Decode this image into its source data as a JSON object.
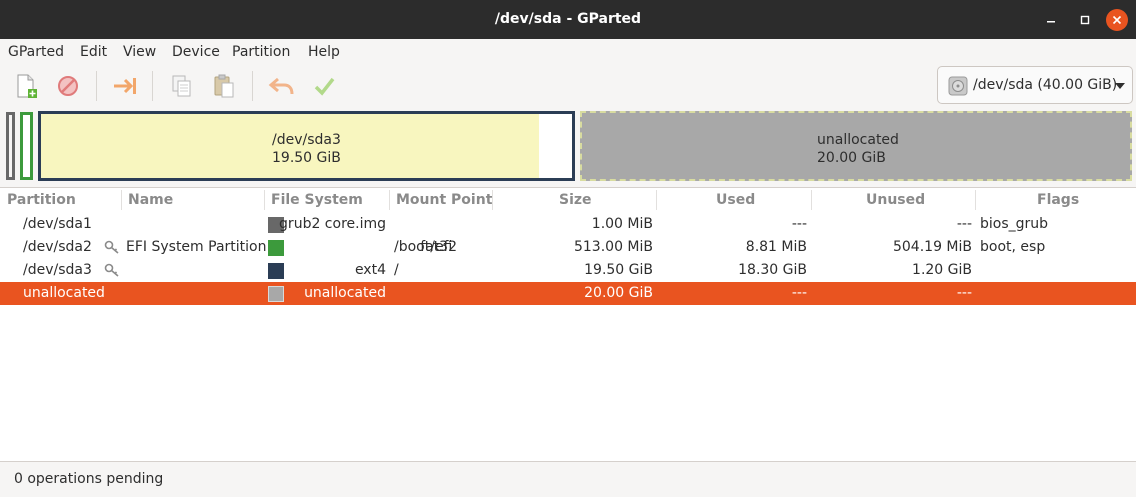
{
  "window": {
    "title": "/dev/sda - GParted"
  },
  "menubar": {
    "items": [
      "GParted",
      "Edit",
      "View",
      "Device",
      "Partition",
      "Help"
    ]
  },
  "toolbar": {
    "icons": [
      "new-partition-icon",
      "delete-icon",
      "resize-move-icon",
      "copy-icon",
      "paste-icon",
      "undo-icon",
      "apply-icon"
    ],
    "device_label": "/dev/sda (40.00 GiB)"
  },
  "diskmap": {
    "sda3": {
      "name": "/dev/sda3",
      "size": "19.50 GiB",
      "used_fraction": 0.938
    },
    "unallocated": {
      "name": "unallocated",
      "size": "20.00 GiB"
    }
  },
  "colors": {
    "accent": "#e95420",
    "grub": "#686868",
    "fat32": "#3c9a3c",
    "ext4": "#2b3d55",
    "unallocated": "#a8a8a8"
  },
  "table": {
    "headers": {
      "partition": "Partition",
      "name": "Name",
      "filesystem": "File System",
      "mount": "Mount Point",
      "size": "Size",
      "used": "Used",
      "unused": "Unused",
      "flags": "Flags"
    },
    "rows": [
      {
        "partition": "/dev/sda1",
        "name": "",
        "filesystem": "grub2 core.img",
        "mount": "",
        "size": "1.00 MiB",
        "used": "---",
        "unused": "---",
        "flags": "bios_grub"
      },
      {
        "partition": "/dev/sda2",
        "name": "EFI System Partition",
        "filesystem": "fat32",
        "mount": "/boot/efi",
        "size": "513.00 MiB",
        "used": "8.81 MiB",
        "unused": "504.19 MiB",
        "flags": "boot, esp"
      },
      {
        "partition": "/dev/sda3",
        "name": "",
        "filesystem": "ext4",
        "mount": "/",
        "size": "19.50 GiB",
        "used": "18.30 GiB",
        "unused": "1.20 GiB",
        "flags": ""
      },
      {
        "partition": "unallocated",
        "name": "",
        "filesystem": "unallocated",
        "mount": "",
        "size": "20.00 GiB",
        "used": "---",
        "unused": "---",
        "flags": ""
      }
    ]
  },
  "status": {
    "text": "0 operations pending"
  }
}
